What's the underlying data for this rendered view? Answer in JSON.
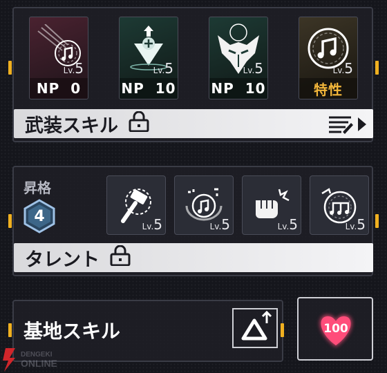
{
  "skills": [
    {
      "tag": "NP",
      "value": "0",
      "lv_prefix": "Lv.",
      "lv": "5",
      "icon": "music-note-icon"
    },
    {
      "tag": "NP",
      "value": "10",
      "lv_prefix": "Lv.",
      "lv": "5",
      "icon": "spotlight-icon"
    },
    {
      "tag": "NP",
      "value": "10",
      "lv_prefix": "Lv.",
      "lv": "5",
      "icon": "mask-icon"
    },
    {
      "tag": "特性",
      "value": "",
      "lv_prefix": "Lv.",
      "lv": "5",
      "icon": "music-note-icon"
    }
  ],
  "weapon_skill": {
    "label": "武装スキル"
  },
  "ascension": {
    "label": "昇格",
    "level": "4"
  },
  "talents": [
    {
      "lv_prefix": "Lv.",
      "lv": "5",
      "icon": "hammer-icon"
    },
    {
      "lv_prefix": "Lv.",
      "lv": "5",
      "icon": "music-note-icon"
    },
    {
      "lv_prefix": "Lv.",
      "lv": "5",
      "icon": "fist-icon"
    },
    {
      "lv_prefix": "Lv.",
      "lv": "5",
      "icon": "triple-note-icon"
    }
  ],
  "talent": {
    "label": "タレント"
  },
  "base_skill": {
    "label": "基地スキル"
  },
  "affection": {
    "value": "100"
  },
  "watermark": {
    "line1": "DENGEKI",
    "line2": "ONLINE"
  },
  "colors": {
    "accent": "#f0b020",
    "trait": "#f3b63a",
    "heart": "#ff4d7a"
  }
}
